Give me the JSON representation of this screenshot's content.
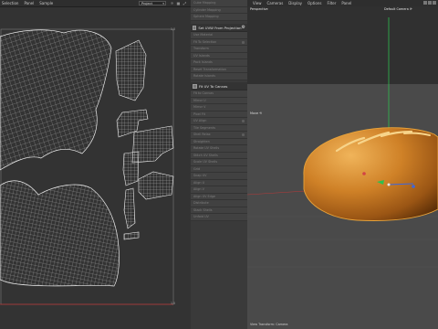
{
  "uv_editor": {
    "menu": [
      "Selection",
      "Panel",
      "Sample"
    ],
    "projection_select": "Project",
    "tools": [
      "sun-icon",
      "grid-icon",
      "expand-icon"
    ],
    "axis_labels": {
      "top_right": "1,0",
      "bottom_right": "1,0"
    }
  },
  "panel": {
    "top_rows": [
      "Cube Mapping",
      "Cylinder Mapping",
      "Sphere Mapping",
      "Box Mapping",
      "Shrink Wrap"
    ],
    "section1_title": "Set UVW From Projection",
    "section1_rows": [
      "Use Material",
      "Fit To Selection",
      "Transform",
      "UV Islands",
      "Pack Islands",
      "Reset Transformation",
      "Rotate Islands",
      "Flip Islands"
    ],
    "section2_title": "Fit UV To Canvas",
    "section2_rows": [
      "Fit to Canvas",
      "Mirror U",
      "Mirror V",
      "Pixel Fit",
      "UV Align",
      "Tile Segments",
      "Shell Relax",
      "Straighten",
      "Rotate UV Shells",
      "Stitch UV Shells",
      "Scale UV Shells",
      "Grid",
      "Snap UV",
      "Align U",
      "Align V",
      "Align UV Edge",
      "Distribute",
      "Stack Shells",
      "Unfold UV",
      "Relax",
      "Weld",
      "Restore"
    ]
  },
  "viewport": {
    "menu": [
      "View",
      "Cameras",
      "Display",
      "Options",
      "Filter",
      "Panel"
    ],
    "view_name": "Perspective",
    "camera_name": "Default Camera ⟳",
    "axis_label": "Move ⟲",
    "status_text": "View Transform: Camera"
  },
  "colors": {
    "uv_wire": "#e6e6e6",
    "bread_crust": "#c87d24",
    "selection": "#e8a33a"
  }
}
